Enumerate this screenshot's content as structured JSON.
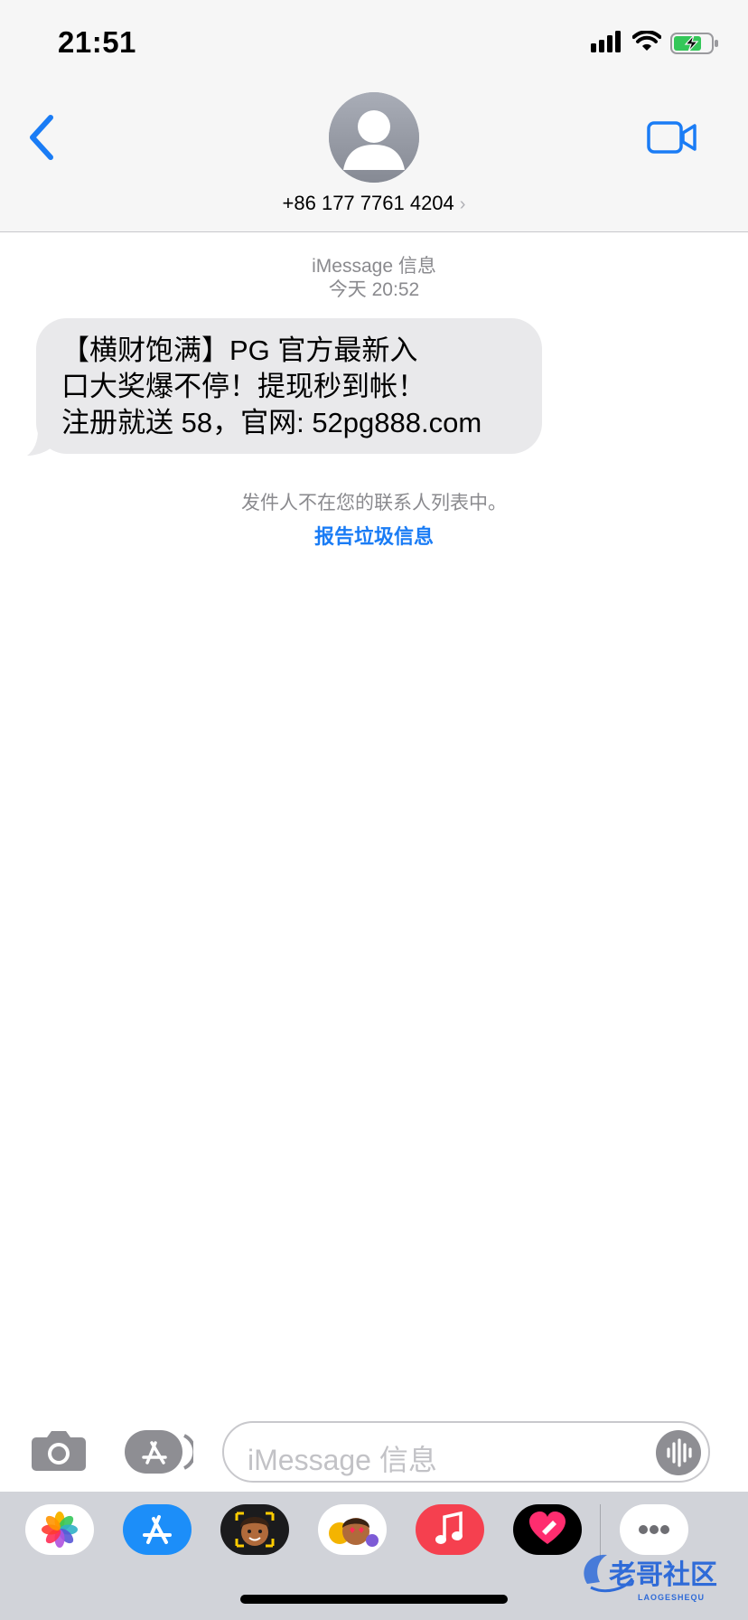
{
  "status_bar": {
    "time": "21:51",
    "icons": [
      "cellular-signal-icon",
      "wifi-icon",
      "battery-charging-icon"
    ]
  },
  "header": {
    "contact": "+86 177 7761 4204",
    "chevron": "›",
    "back_icon": "chevron-left-icon",
    "video_icon": "video-camera-icon",
    "avatar_icon": "person-silhouette-icon"
  },
  "conversation": {
    "service": "iMessage 信息",
    "timestamp": "今天 20:52",
    "message": {
      "lines": [
        "【横财饱满】PG 官方最新入",
        "口大奖爆不停！提现秒到帐！",
        "注册就送 58，官网: 52pg888.com"
      ]
    },
    "notice": "发件人不在您的联系人列表中。",
    "report_link": "报告垃圾信息"
  },
  "input_bar": {
    "placeholder": "iMessage 信息",
    "camera_icon": "camera-icon",
    "apps_icon": "app-store-icon",
    "voice_icon": "waveform-icon"
  },
  "app_drawer": {
    "apps": [
      "photos-icon",
      "app-store-icon",
      "memoji-icon",
      "animoji-stickers-icon",
      "music-icon",
      "digital-touch-icon",
      "more-icon"
    ]
  },
  "watermark": {
    "text": "老哥社区",
    "subtext": "LAOGESHEQU"
  },
  "colors": {
    "accent": "#1a7cf5",
    "bubble": "#e9e9eb",
    "header_bg": "#f6f6f6",
    "drawer_bg": "#d1d3d9"
  }
}
